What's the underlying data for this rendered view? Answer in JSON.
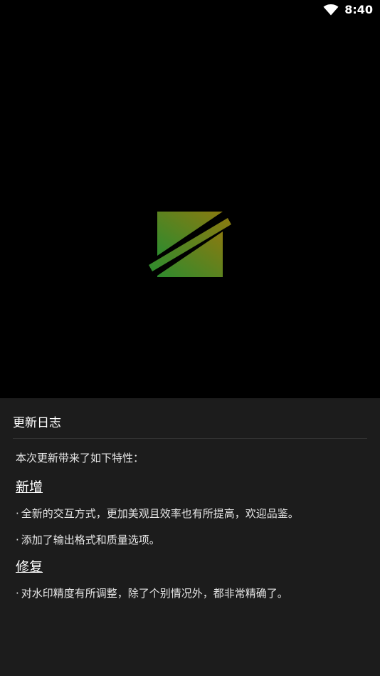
{
  "status_bar": {
    "time": "8:40",
    "wifi_icon": "wifi-icon"
  },
  "splash": {
    "logo_icon": "app-logo-icon",
    "logo_colors": {
      "green": "#2e8b2e",
      "olive": "#8a7a10"
    }
  },
  "changelog": {
    "title": "更新日志",
    "intro": "本次更新带来了如下特性：",
    "sections": [
      {
        "heading": "新增",
        "items": [
          "全新的交互方式，更加美观且效率也有所提高，欢迎品鉴。",
          "添加了输出格式和质量选项。"
        ]
      },
      {
        "heading": "修复",
        "items": [
          "对水印精度有所调整，除了个别情况外，都非常精确了。"
        ]
      }
    ],
    "bullet": "·"
  },
  "colors": {
    "background": "#000000",
    "sheet": "#1c1c1c",
    "text": "#e6e6e6"
  }
}
